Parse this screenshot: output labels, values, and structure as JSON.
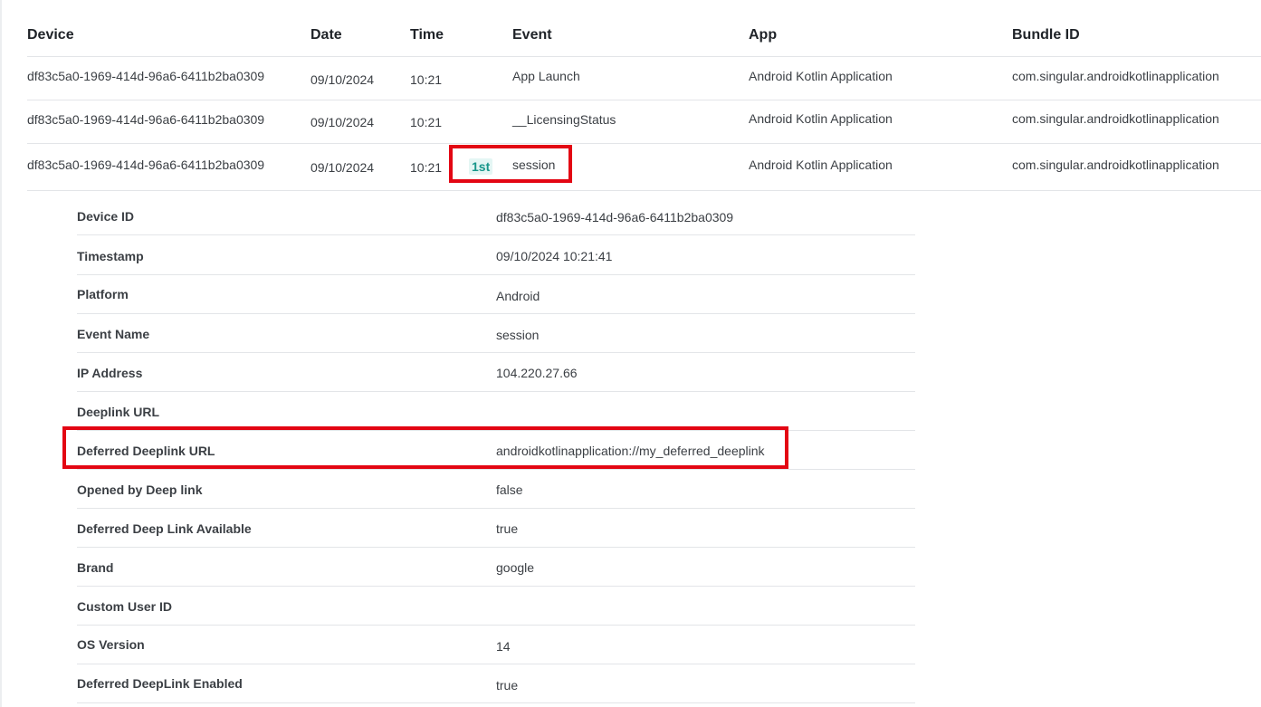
{
  "table": {
    "headers": {
      "device": "Device",
      "date": "Date",
      "time": "Time",
      "event": "Event",
      "app": "App",
      "bundle": "Bundle ID"
    },
    "rows": [
      {
        "device": "df83c5a0-1969-414d-96a6-6411b2ba0309",
        "date": "09/10/2024",
        "time": "10:21",
        "event": "App Launch",
        "app": "Android Kotlin Application",
        "bundle": "com.singular.androidkotlinapplication"
      },
      {
        "device": "df83c5a0-1969-414d-96a6-6411b2ba0309",
        "date": "09/10/2024",
        "time": "10:21",
        "event": "__LicensingStatus",
        "app": "Android Kotlin Application",
        "bundle": "com.singular.androidkotlinapplication"
      },
      {
        "device": "df83c5a0-1969-414d-96a6-6411b2ba0309",
        "date": "09/10/2024",
        "time": "10:21",
        "badge": "1st",
        "event": "session",
        "app": "Android Kotlin Application",
        "bundle": "com.singular.androidkotlinapplication"
      }
    ]
  },
  "details": [
    {
      "key": "Device ID",
      "value": "df83c5a0-1969-414d-96a6-6411b2ba0309"
    },
    {
      "key": "Timestamp",
      "value": "09/10/2024 10:21:41"
    },
    {
      "key": "Platform",
      "value": "Android"
    },
    {
      "key": "Event Name",
      "value": "session"
    },
    {
      "key": "IP Address",
      "value": "104.220.27.66"
    },
    {
      "key": "Deeplink URL",
      "value": ""
    },
    {
      "key": "Deferred Deeplink URL",
      "value": "androidkotlinapplication://my_deferred_deeplink"
    },
    {
      "key": "Opened by Deep link",
      "value": "false"
    },
    {
      "key": "Deferred Deep Link Available",
      "value": "true"
    },
    {
      "key": "Brand",
      "value": "google"
    },
    {
      "key": "Custom User ID",
      "value": ""
    },
    {
      "key": "OS Version",
      "value": "14"
    },
    {
      "key": "Deferred DeepLink Enabled",
      "value": "true"
    }
  ],
  "colors": {
    "highlight": "#e30613",
    "badge_bg": "#e4f6f4",
    "badge_text": "#17968a"
  }
}
